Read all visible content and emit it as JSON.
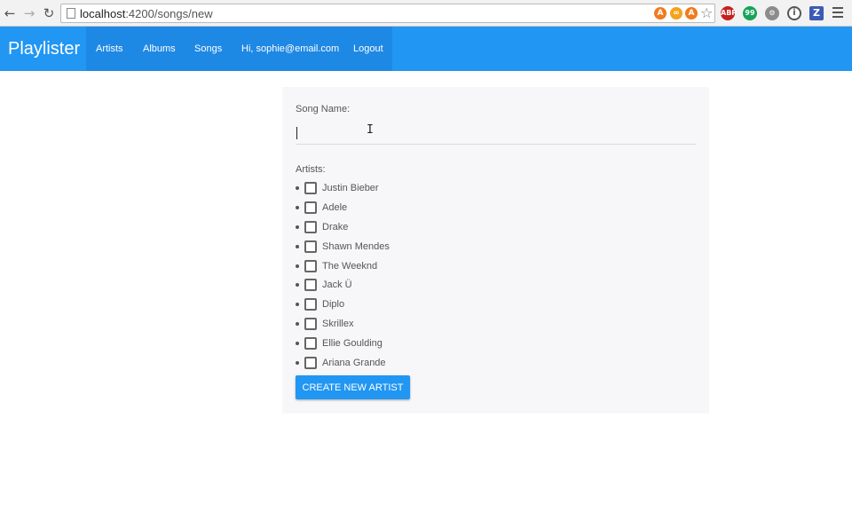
{
  "browser": {
    "url_host": "localhost",
    "url_path": ":4200/songs/new",
    "extensions": {
      "abp": "ABP",
      "hangouts": "99",
      "info": "i",
      "z": "Z",
      "in_a1": "A",
      "in_a2": "∞",
      "in_a3": "A"
    }
  },
  "navbar": {
    "brand": "Playlister",
    "links": [
      "Artists",
      "Albums",
      "Songs",
      "Hi, sophie@email.com",
      "Logout"
    ]
  },
  "form": {
    "song_label": "Song Name:",
    "song_value": "",
    "artists_label": "Artists:",
    "artists": [
      "Justin Bieber",
      "Adele",
      "Drake",
      "Shawn Mendes",
      "The Weeknd",
      "Jack Ü",
      "Diplo",
      "Skrillex",
      "Ellie Goulding",
      "Ariana Grande"
    ],
    "create_button": "CREATE NEW ARTIST"
  },
  "colors": {
    "primary": "#2196f3",
    "primary_dark": "#1e88e5",
    "panel_bg": "#f7f7f9"
  }
}
